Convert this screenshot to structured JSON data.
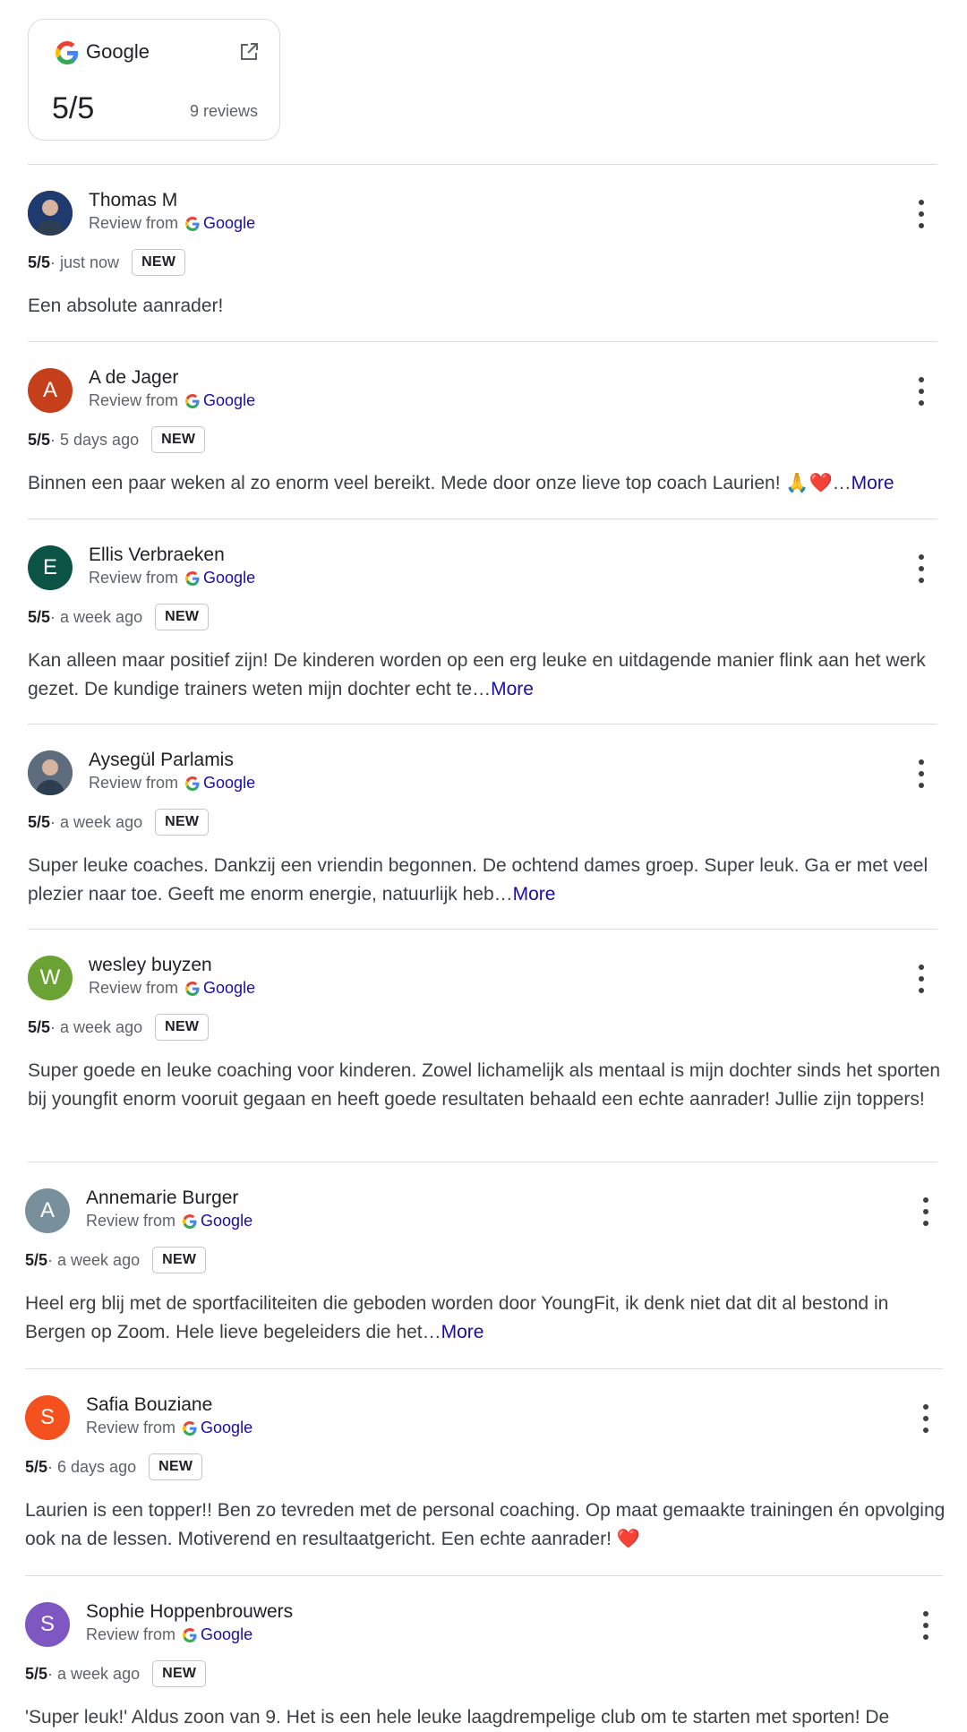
{
  "summary": {
    "provider": "Google",
    "score": "5/5",
    "count": "9 reviews",
    "icons": [
      "google-g-icon",
      "open-in-new-icon"
    ]
  },
  "source_label": "Review from",
  "source_link": "Google",
  "more_label": "More",
  "badge": "NEW",
  "colors": {
    "link": "#1a0dab",
    "divider": "#dadce0",
    "text": "#3c4043"
  },
  "reviews": [
    {
      "name": "Thomas M",
      "initial": "",
      "avatar_color": "#1f3a6e",
      "photo": true,
      "rating": "5/5",
      "time": " · just now",
      "text": "Een absolute aanrader!",
      "more": false
    },
    {
      "name": "A de Jager",
      "initial": "A",
      "avatar_color": "#c5401a",
      "photo": false,
      "rating": "5/5",
      "time": " · 5 days ago",
      "text": "Binnen een paar weken al zo enorm veel bereikt. Mede door onze lieve top coach Laurien! 🙏❤️…",
      "more": true
    },
    {
      "name": "Ellis Verbraeken",
      "initial": "E",
      "avatar_color": "#0b5345",
      "photo": false,
      "rating": "5/5",
      "time": " · a week ago",
      "text": "Kan alleen maar positief zijn! De kinderen worden op een erg leuke en uitdagende manier flink aan het werk gezet. De kundige trainers weten mijn dochter echt te…",
      "more": true
    },
    {
      "name": "Aysegül Parlamis",
      "initial": "",
      "avatar_color": "#5d6d7e",
      "photo": true,
      "rating": "5/5",
      "time": " · a week ago",
      "text": "Super leuke coaches. Dankzij een vriendin begonnen. De ochtend dames groep. Super leuk. Ga er met veel plezier naar toe. Geeft me enorm energie, natuurlijk heb…",
      "more": true
    },
    {
      "name": "wesley buyzen",
      "initial": "W",
      "avatar_color": "#6aa334",
      "photo": false,
      "rating": "5/5",
      "time": " · a week ago",
      "text": "Super goede en leuke coaching voor kinderen. Zowel lichamelijk als mentaal is mijn dochter sinds het sporten bij youngfit enorm vooruit gegaan en heeft goede resultaten behaald een echte aanrader! Jullie zijn toppers!",
      "more": false
    },
    {
      "name": "Annemarie Burger",
      "initial": "A",
      "avatar_color": "#78909c",
      "photo": false,
      "rating": "5/5",
      "time": " · a week ago",
      "text": "Heel erg blij met de sportfaciliteiten die geboden worden door YoungFit, ik denk niet dat dit al bestond in Bergen op Zoom. Hele lieve begeleiders die het…",
      "more": true
    },
    {
      "name": "Safia Bouziane",
      "initial": "S",
      "avatar_color": "#f4511e",
      "photo": false,
      "rating": "5/5",
      "time": " · 6 days ago",
      "text": "Laurien is een topper!! Ben zo tevreden met de personal coaching. Op maat gemaakte trainingen én opvolging ook na de lessen. Motiverend en resultaatgericht. Een echte aanrader! ❤️",
      "more": false
    },
    {
      "name": "Sophie Hoppenbrouwers",
      "initial": "S",
      "avatar_color": "#7e57c2",
      "photo": false,
      "rating": "5/5",
      "time": " · a week ago",
      "text": "'Super leuk!' Aldus zoon van 9. Het is een hele leuke laagdrempelige club om te starten met sporten! De",
      "more": false
    }
  ]
}
